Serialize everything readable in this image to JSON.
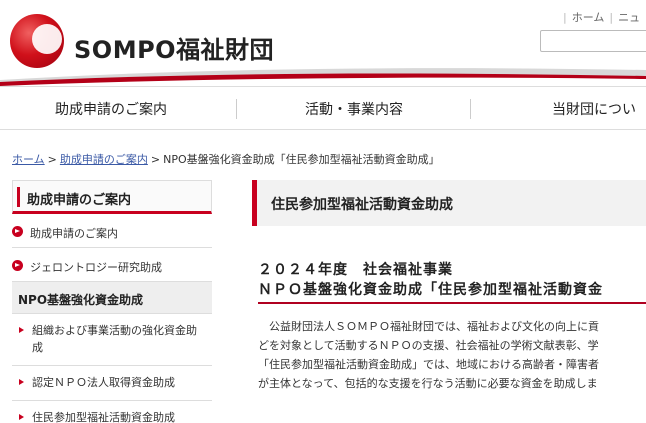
{
  "header": {
    "logo_text": "SOMPO福祉財団",
    "top_links": [
      "ホーム",
      "ニュ"
    ]
  },
  "gnav": {
    "items": [
      "助成申請のご案内",
      "活動・事業内容",
      "当財団につい"
    ]
  },
  "breadcrumb": {
    "home": "ホーム",
    "level1": "助成申請のご案内",
    "current": "NPO基盤強化資金助成「住民参加型福祉活動資金助成」",
    "separator": ">"
  },
  "sidebar": {
    "heading": "助成申請のご案内",
    "items": [
      "助成申請のご案内",
      "ジェロントロジー研究助成"
    ],
    "category": "NPO基盤強化資金助成",
    "subitems": [
      "組織および事業活動の強化資金助成",
      "認定ＮＰＯ法人取得資金助成",
      "住民参加型福祉活動資金助成"
    ]
  },
  "main": {
    "heading": "住民参加型福祉活動資金助成",
    "title_line1": "２０２４年度　社会福祉事業",
    "title_line2": "ＮＰＯ基盤強化資金助成「住民参加型福祉活動資金",
    "body": [
      "公益財団法人ＳＯＭＰＯ福祉財団では、福祉および文化の向上に貢",
      "どを対象として活動するＮＰＯの支援、社会福祉の学術文献表彰、学",
      "「住民参加型福祉活動資金助成」では、地域における高齢者・障害者",
      "が主体となって、包括的な支援を行なう活動に必要な資金を助成しま"
    ]
  },
  "colors": {
    "accent": "#c8001f",
    "link": "#3b5aa6"
  }
}
